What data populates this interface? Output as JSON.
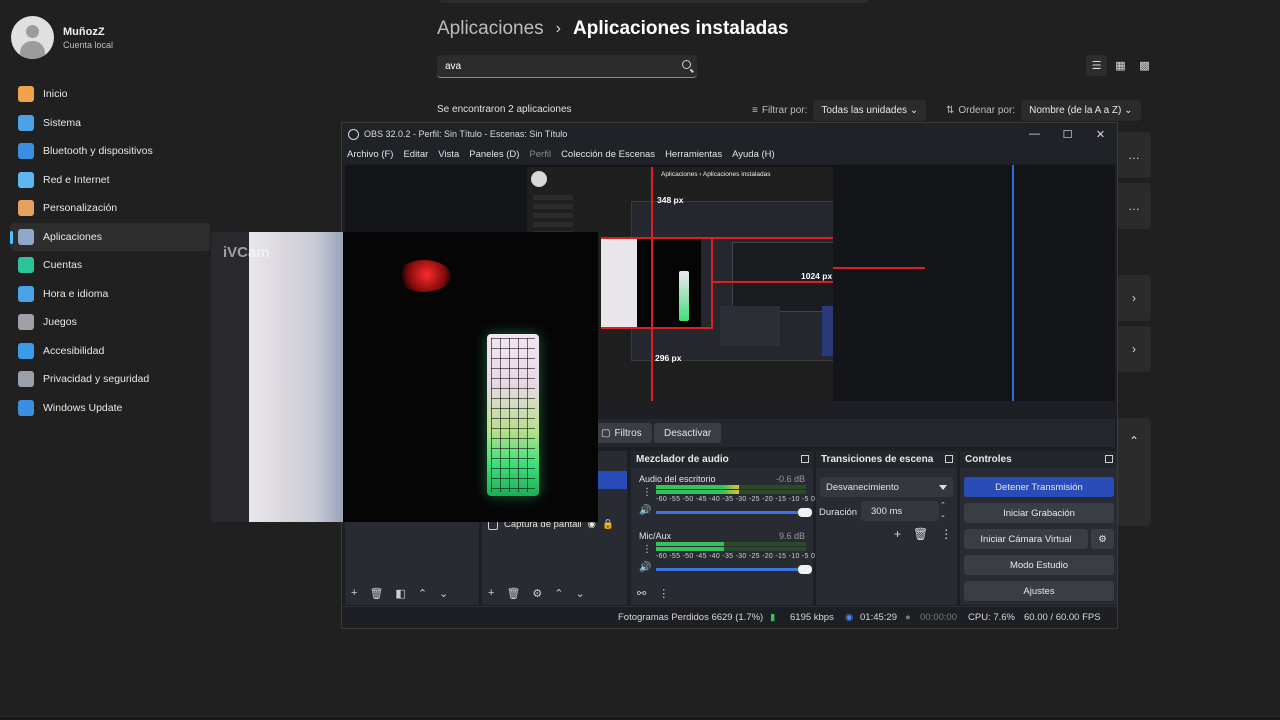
{
  "settings": {
    "user": {
      "name": "MuñozZ",
      "account": "Cuenta local"
    },
    "nav": [
      {
        "label": "Inicio",
        "icon": "home-icon",
        "color": "#f0a34a"
      },
      {
        "label": "Sistema",
        "icon": "system-icon",
        "color": "#4aa3e8"
      },
      {
        "label": "Bluetooth y dispositivos",
        "icon": "bluetooth-icon",
        "color": "#3c8fe0"
      },
      {
        "label": "Red e Internet",
        "icon": "wifi-icon",
        "color": "#5db8f0"
      },
      {
        "label": "Personalización",
        "icon": "brush-icon",
        "color": "#e8a060"
      },
      {
        "label": "Aplicaciones",
        "icon": "apps-icon",
        "color": "#8fa8c8"
      },
      {
        "label": "Cuentas",
        "icon": "person-icon",
        "color": "#2ec29a"
      },
      {
        "label": "Hora e idioma",
        "icon": "globe-clock-icon",
        "color": "#4aa3e8"
      },
      {
        "label": "Juegos",
        "icon": "gamepad-icon",
        "color": "#a0a0a8"
      },
      {
        "label": "Accesibilidad",
        "icon": "accessibility-icon",
        "color": "#3c9be8"
      },
      {
        "label": "Privacidad y seguridad",
        "icon": "shield-icon",
        "color": "#9aa0a8"
      },
      {
        "label": "Windows Update",
        "icon": "update-icon",
        "color": "#3c8fe0"
      }
    ],
    "active_nav": "Aplicaciones",
    "breadcrumb": {
      "parent": "Aplicaciones",
      "separator": "›",
      "current": "Aplicaciones instaladas"
    },
    "search_value": "ava",
    "result_text": "Se encontraron 2 aplicaciones",
    "filter": {
      "label": "Filtrar por:",
      "value": "Todas las unidades"
    },
    "sort": {
      "label": "Ordenar por:",
      "value": "Nombre (de la A a Z)"
    },
    "card_actions": [
      "…",
      "…",
      "›",
      "›",
      "⌃"
    ]
  },
  "obs": {
    "title": "OBS 32.0.2 - Perfil: Sin Título - Escenas: Sin Título",
    "window_controls": [
      "—",
      "☐",
      "✕"
    ],
    "menu": [
      {
        "label": "Archivo (F)"
      },
      {
        "label": "Editar"
      },
      {
        "label": "Vista"
      },
      {
        "label": "Paneles (D)"
      },
      {
        "label": "Perfil",
        "disabled": true
      },
      {
        "label": "Colección de Escenas"
      },
      {
        "label": "Herramientas"
      },
      {
        "label": "Ayuda (H)"
      }
    ],
    "preview": {
      "nested_breadcrumb": "Aplicaciones › Aplicaciones instaladas",
      "labels": [
        "348 px",
        "1024 px",
        "296 px"
      ]
    },
    "source_toolbar": {
      "filters": "Filtros",
      "deactivate": "Desactivar"
    },
    "sources": [
      {
        "name": "Captura de pantall"
      }
    ],
    "mixer": {
      "title": "Mezclador de audio",
      "channels": [
        {
          "name": "Audio del escritorio",
          "db": "-0.6 dB",
          "level": 0.55
        },
        {
          "name": "Mic/Aux",
          "db": "9.6 dB",
          "level": 0.45
        }
      ],
      "ticks": "-60 -55 -50 -45 -40 -35 -30 -25 -20 -15 -10 -5 0"
    },
    "transitions": {
      "title": "Transiciones de escena",
      "selected": "Desvanecimiento",
      "duration_label": "Duración",
      "duration_value": "300 ms"
    },
    "controls": {
      "title": "Controles",
      "buttons": [
        "Detener Transmisión",
        "Iniciar Grabación",
        "Iniciar Cámara Virtual",
        "Modo Estudio",
        "Ajustes"
      ]
    },
    "status": {
      "dropped": "Fotogramas Perdidos 6629 (1.7%)",
      "bitrate": "6195 kbps",
      "stream_time": "01:45:29",
      "rec_time": "00:00:00",
      "cpu": "CPU: 7.6%",
      "fps": "60.00 / 60.00 FPS"
    }
  },
  "ivcam": {
    "watermark": "iVCam"
  }
}
